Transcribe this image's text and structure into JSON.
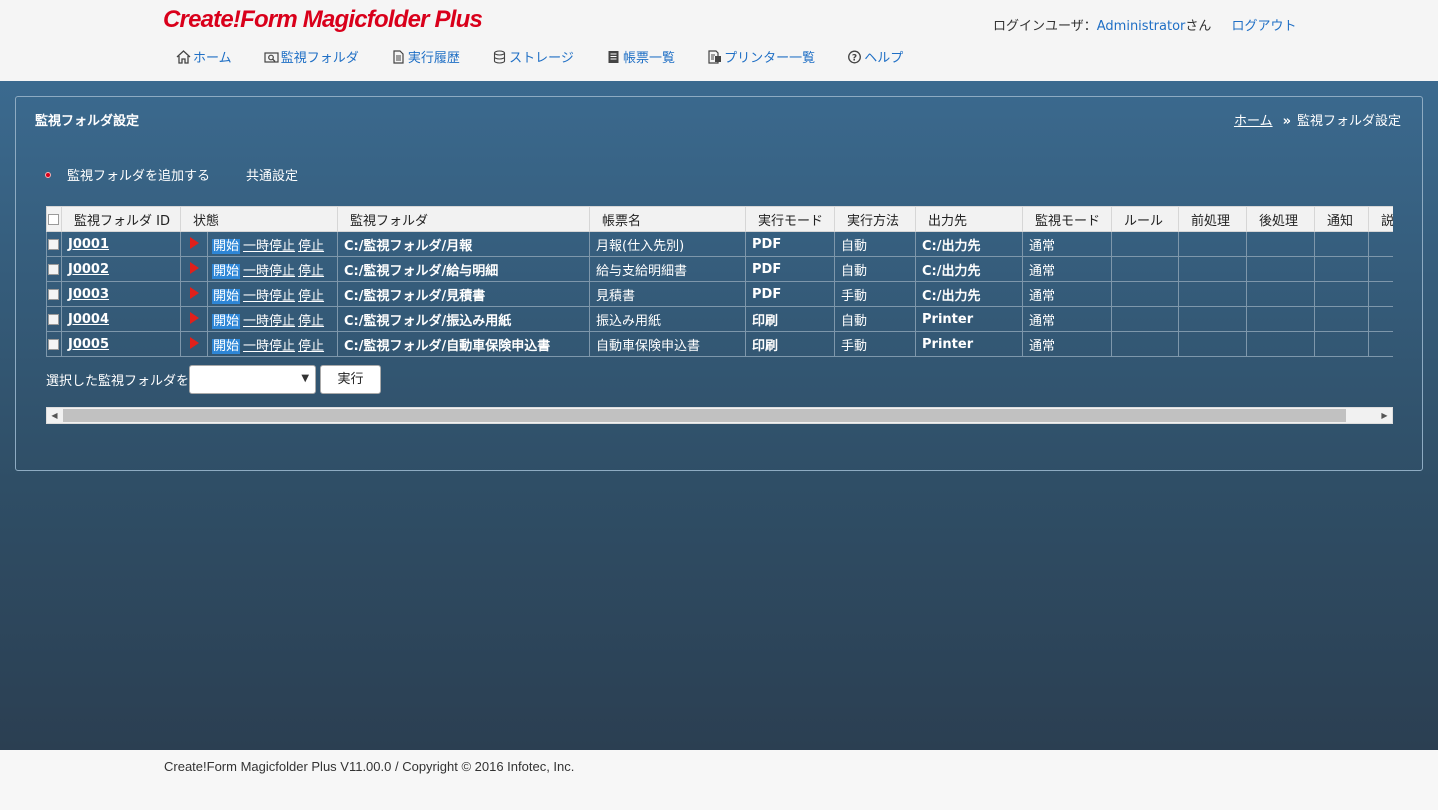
{
  "header": {
    "logo": "Create!Form Magicfolder Plus",
    "login_label": "ログインユーザ：",
    "username": "Administrator",
    "honorific": "さん",
    "logout": "ログアウト"
  },
  "nav": [
    {
      "label": "ホーム",
      "icon": "home-icon"
    },
    {
      "label": "監視フォルダ",
      "icon": "folder-search-icon"
    },
    {
      "label": "実行履歴",
      "icon": "document-icon"
    },
    {
      "label": "ストレージ",
      "icon": "database-icon"
    },
    {
      "label": "帳票一覧",
      "icon": "form-list-icon"
    },
    {
      "label": "プリンター一覧",
      "icon": "printer-icon"
    },
    {
      "label": "ヘルプ",
      "icon": "help-icon"
    }
  ],
  "panel": {
    "title": "監視フォルダ設定",
    "breadcrumb": {
      "home": "ホーム",
      "separator": "»",
      "current": "監視フォルダ設定"
    },
    "actions": {
      "add": "監視フォルダを追加する",
      "common": "共通設定"
    }
  },
  "table": {
    "headers": [
      "監視フォルダ ID",
      "状態",
      "監視フォルダ",
      "帳票名",
      "実行モード",
      "実行方法",
      "出力先",
      "監視モード",
      "ルール",
      "前処理",
      "後処理",
      "通知",
      "説"
    ],
    "status_labels": {
      "start": "開始",
      "pause": "一時停止",
      "stop": "停止"
    },
    "rows": [
      {
        "id": "J0001",
        "folder": "C:/監視フォルダ/月報",
        "form": "月報(仕入先別)",
        "mode": "PDF",
        "method": "自動",
        "output": "C:/出力先",
        "watch": "通常"
      },
      {
        "id": "J0002",
        "folder": "C:/監視フォルダ/給与明細",
        "form": "給与支給明細書",
        "mode": "PDF",
        "method": "自動",
        "output": "C:/出力先",
        "watch": "通常"
      },
      {
        "id": "J0003",
        "folder": "C:/監視フォルダ/見積書",
        "form": "見積書",
        "mode": "PDF",
        "method": "手動",
        "output": "C:/出力先",
        "watch": "通常"
      },
      {
        "id": "J0004",
        "folder": "C:/監視フォルダ/振込み用紙",
        "form": "振込み用紙",
        "mode": "印刷",
        "method": "自動",
        "output": "Printer",
        "watch": "通常"
      },
      {
        "id": "J0005",
        "folder": "C:/監視フォルダ/自動車保険申込書",
        "form": "自動車保険申込書",
        "mode": "印刷",
        "method": "手動",
        "output": "Printer",
        "watch": "通常"
      }
    ]
  },
  "exec": {
    "label": "選択した監視フォルダを",
    "select_value": "",
    "button": "実行"
  },
  "footer": {
    "copyright": "Create!Form Magicfolder Plus V11.00.0 / Copyright © 2016 Infotec, Inc."
  },
  "colors": {
    "accent": "#1f6fc5",
    "logo": "#d9001b",
    "play": "#e0201b",
    "active_status": "#2e86d6"
  }
}
